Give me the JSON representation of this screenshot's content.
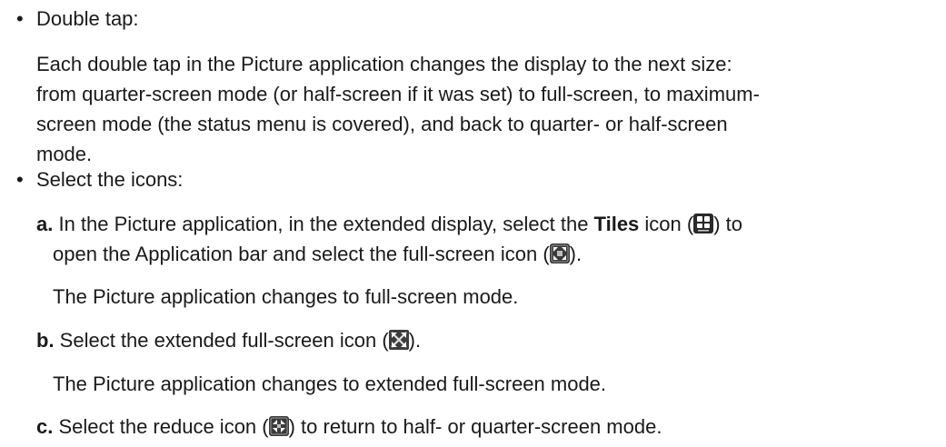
{
  "bullets": [
    {
      "label": "Double tap:",
      "paragraph_lines": [
        "Each double tap in the Picture application changes the display to the next size:",
        "from quarter-screen mode (or half-screen if it was set) to full-screen, to maximum-",
        "screen mode (the status menu is covered), and back to quarter- or half-screen",
        "mode."
      ]
    },
    {
      "label": "Select the icons:",
      "steps": [
        {
          "letter": "a.",
          "line1_before": " In the Picture application, in the extended display, select the ",
          "line1_bold": "Tiles",
          "line1_mid": " icon (",
          "line1_after": ") to",
          "line2_before": "open the Application bar and select the full-screen icon (",
          "line2_after": ").",
          "result": "The Picture application changes to full-screen mode."
        },
        {
          "letter": "b.",
          "before": " Select the extended full-screen icon (",
          "after": ").",
          "result": "The Picture application changes to extended full-screen mode."
        },
        {
          "letter": "c.",
          "before": " Select the reduce icon (",
          "after": ") to return to half- or quarter-screen mode."
        }
      ]
    }
  ],
  "icons": {
    "tiles": "tiles-icon",
    "full_screen": "full-screen-icon",
    "extended_full_screen": "extended-full-screen-icon",
    "reduce": "reduce-icon"
  }
}
